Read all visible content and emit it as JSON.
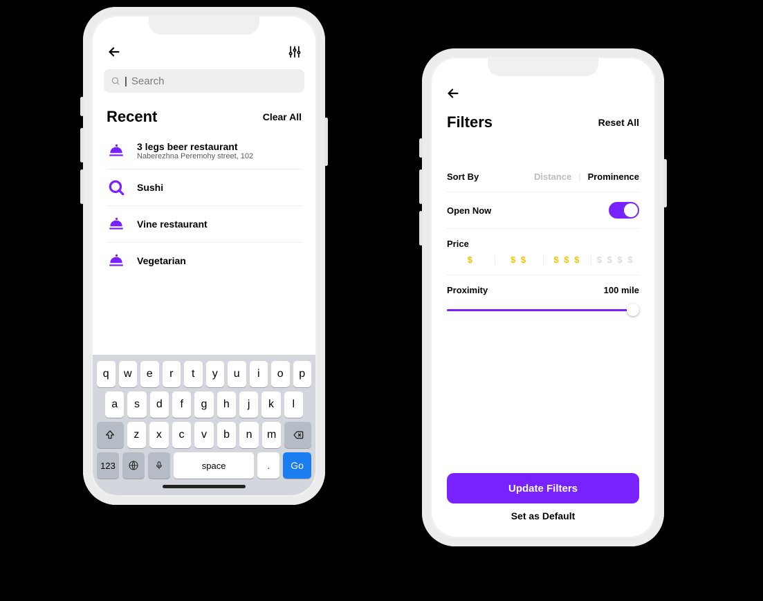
{
  "left": {
    "search": {
      "placeholder": "Search"
    },
    "recent": {
      "title": "Recent",
      "clear": "Clear All",
      "items": [
        {
          "icon": "cloche",
          "title": "3 legs beer restaurant",
          "sub": "Naberezhna Peremohy street, 102"
        },
        {
          "icon": "search",
          "title": "Sushi",
          "sub": ""
        },
        {
          "icon": "cloche",
          "title": "Vine restaurant",
          "sub": ""
        },
        {
          "icon": "cloche",
          "title": "Vegetarian",
          "sub": ""
        }
      ]
    },
    "keyboard": {
      "row1": [
        "q",
        "w",
        "e",
        "r",
        "t",
        "y",
        "u",
        "i",
        "o",
        "p"
      ],
      "row2": [
        "a",
        "s",
        "d",
        "f",
        "g",
        "h",
        "j",
        "k",
        "l"
      ],
      "row3": [
        "z",
        "x",
        "c",
        "v",
        "b",
        "n",
        "m"
      ],
      "numKey": "123",
      "space": "space",
      "dot": ".",
      "go": "Go"
    }
  },
  "right": {
    "title": "Filters",
    "reset": "Reset All",
    "sort": {
      "label": "Sort By",
      "opt1": "Distance",
      "opt2": "Prominence"
    },
    "open": {
      "label": "Open Now"
    },
    "price": {
      "label": "Price",
      "levels": [
        "$",
        "$ $",
        "$ $ $",
        "$ $ $ $"
      ]
    },
    "prox": {
      "label": "Proximity",
      "value": "100 mile"
    },
    "update": "Update Filters",
    "default": "Set as Default"
  }
}
